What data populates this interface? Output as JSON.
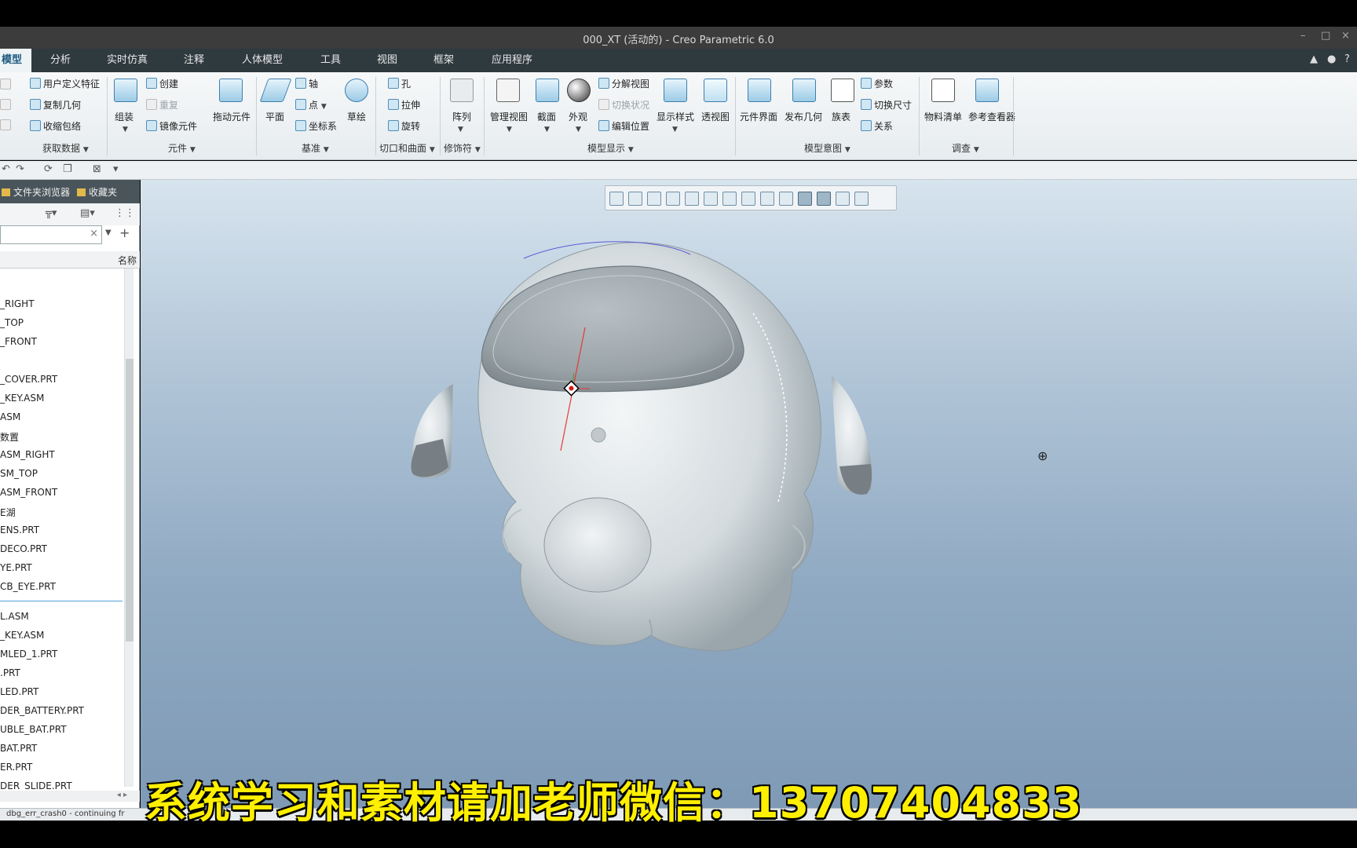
{
  "window": {
    "title": "000_XT (活动的) - Creo Parametric 6.0",
    "min": "–",
    "max": "□",
    "close": "×"
  },
  "menu": {
    "tabs": [
      "模型",
      "分析",
      "实时仿真",
      "注释",
      "人体模型",
      "工具",
      "视图",
      "框架",
      "应用程序"
    ],
    "right_icons": [
      "▲",
      "●",
      "?"
    ]
  },
  "ribbon": {
    "get_data": {
      "items": [
        "用户定义特征",
        "复制几何",
        "收缩包络"
      ],
      "group": "获取数据"
    },
    "component": {
      "assemble": "组装",
      "create": "创建",
      "repeat": "重复",
      "mirror": "镜像元件",
      "drag": "拖动元件",
      "group": "元件"
    },
    "datum": {
      "plane": "平面",
      "axis": "轴",
      "point": "点",
      "csys": "坐标系",
      "sketch": "草绘",
      "group": "基准"
    },
    "cut_surface": {
      "hole": "孔",
      "extrude": "拉伸",
      "revolve": "旋转",
      "group": "切口和曲面"
    },
    "modifiers": {
      "pattern": "阵列",
      "group": "修饰符"
    },
    "model_display": {
      "manage_views": "管理视图",
      "section": "截面",
      "appearance": "外观",
      "exploded": "分解视图",
      "toggle_status": "切换状况",
      "edit_position": "编辑位置",
      "display_style": "显示样式",
      "perspective": "透视图",
      "group": "模型显示"
    },
    "model_intent": {
      "comp_interface": "元件界面",
      "publish_geom": "发布几何",
      "family_table": "族表",
      "params": "参数",
      "switch_dims": "切换尺寸",
      "relations": "关系",
      "group": "模型意图"
    },
    "investigate": {
      "bom": "物料清单",
      "ref_viewer": "参考查看器",
      "group": "调查"
    }
  },
  "left_panel": {
    "tabs": [
      "文件夹浏览器",
      "收藏夹"
    ],
    "column_header": "名称",
    "search_clear": "×",
    "tree_items": [
      "_RIGHT",
      "_TOP",
      "_FRONT",
      "_COVER.PRT",
      "_KEY.ASM",
      "ASM",
      "数置",
      "ASM_RIGHT",
      "SM_TOP",
      "ASM_FRONT",
      "E湖",
      "ENS.PRT",
      "DECO.PRT",
      "YE.PRT",
      "CB_EYE.PRT",
      "L.ASM",
      "_KEY.ASM",
      "MLED_1.PRT",
      ".PRT",
      "LED.PRT",
      "DER_BATTERY.PRT",
      "UBLE_BAT.PRT",
      "BAT.PRT",
      "ER.PRT",
      "DER_SLIDE.PRT"
    ]
  },
  "status": {
    "message": "dbg_err_crash0 - continuing fr"
  },
  "caption": "系统学习和素材请加老师微信：13707404833",
  "colors": {
    "model_body": "#dfe4e6",
    "model_shade": "#8f9aa0",
    "caption": "#ffef00",
    "background_top": "#d7e4ee",
    "background_bottom": "#7f9ab5"
  }
}
